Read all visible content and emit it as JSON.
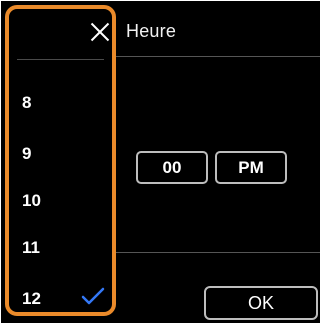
{
  "screen": {
    "title": "Heure",
    "minutes_value": "00",
    "ampm_value": "PM",
    "ok_label": "OK"
  },
  "picker": {
    "close_icon": "close-icon",
    "hours": [
      "8",
      "9",
      "10",
      "11",
      "12"
    ],
    "selected_hour": "12",
    "check_icon": "checkmark-icon",
    "accent_color": "#3478f6",
    "highlight_color": "#ea8a2a"
  }
}
